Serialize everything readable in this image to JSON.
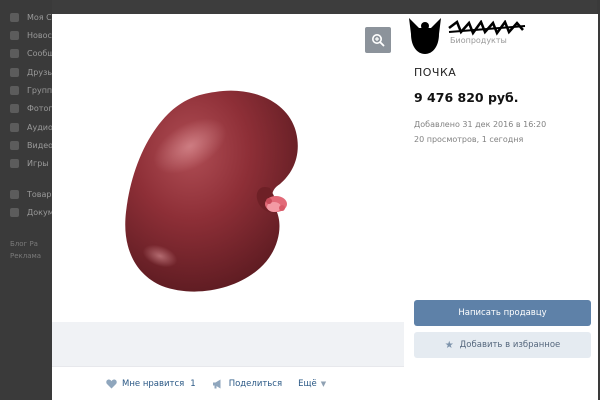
{
  "background": {
    "sidebar_items": [
      {
        "label": "Моя Стр",
        "icon": "home-icon"
      },
      {
        "label": "Новости",
        "icon": "news-icon"
      },
      {
        "label": "Сообщения",
        "icon": "messages-icon"
      },
      {
        "label": "Друзья",
        "icon": "friends-icon"
      },
      {
        "label": "Группы",
        "icon": "groups-icon"
      },
      {
        "label": "Фотографии",
        "icon": "photos-icon"
      },
      {
        "label": "Аудиозаписи",
        "icon": "music-icon"
      },
      {
        "label": "Видеозаписи",
        "icon": "video-icon"
      },
      {
        "label": "Игры",
        "icon": "games-icon"
      },
      {
        "label": "Товары",
        "icon": "goods-icon"
      },
      {
        "label": "Документы",
        "icon": "docs-icon"
      }
    ],
    "footer_line1": "Блог  Ра",
    "footer_line2": "Реклама"
  },
  "seller": {
    "name": "Биопродукты"
  },
  "product": {
    "title": "ПОЧКА",
    "price": "9 476 820 руб.",
    "added": "Добавлено 31 дек 2016 в 16:20",
    "views": "20 просмотров, 1 сегодня"
  },
  "buttons": {
    "write_seller": "Написать продавцу",
    "add_favorite": "Добавить в избранное"
  },
  "actions": {
    "like_label": "Мне нравится",
    "like_count": "1",
    "share_label": "Поделиться",
    "more_label": "Ещё"
  },
  "colors": {
    "primary_button": "#5e81a8",
    "link": "#2a5885",
    "secondary_button": "#e5ebf1"
  }
}
